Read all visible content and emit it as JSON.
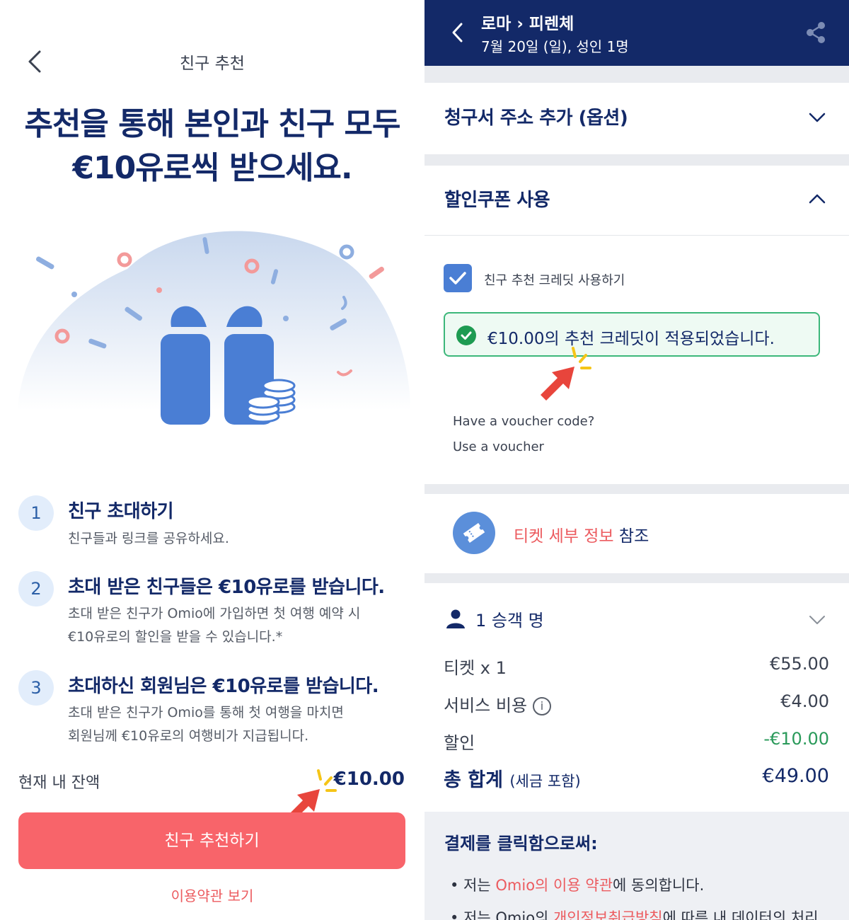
{
  "left": {
    "header_title": "친구 추천",
    "headline_line1": "추천을 통해 본인과 친구 모두",
    "headline_line2": "€10유로씩 받으세요.",
    "steps": [
      {
        "num": "1",
        "title": "친구 초대하기",
        "desc": "친구들과 링크를 공유하세요."
      },
      {
        "num": "2",
        "title": "초대 받은 친구들은 €10유로를 받습니다.",
        "desc_line1": "초대 받은 친구가 Omio에 가입하면 첫 여행 예약 시",
        "desc_line2": "€10유로의 할인을 받을 수 있습니다.*"
      },
      {
        "num": "3",
        "title": "초대하신 회원님은 €10유로를 받습니다.",
        "desc_line1": "초대 받은 친구가 Omio를 통해 첫 여행을 마치면",
        "desc_line2": "회원님께 €10유로의 여행비가 지급됩니다."
      }
    ],
    "balance_label": "현재 내 잔액",
    "balance_value": "€10.00",
    "cta_label": "친구 추천하기",
    "terms_link": "이용약관 보기"
  },
  "right": {
    "route": "로마 › 피렌체",
    "date_line": "7월 20일 (일), 성인 1명",
    "billing_title": "청구서 주소 추가 (옵션)",
    "coupon_title": "할인쿠폰 사용",
    "checkbox_label": "친구 추천 크레딧 사용하기",
    "success_message": "€10.00의 추천 크레딧이 적용되었습니다.",
    "voucher_question": "Have a voucher code?",
    "voucher_link": "Use a voucher",
    "ticket_link_red": "티켓 세부 정보",
    "ticket_link_suffix": " 참조",
    "passengers": "1 승객 명",
    "rows": [
      {
        "label": "티켓 x 1",
        "value": "€55.00"
      },
      {
        "label": "서비스 비용",
        "value": "€4.00"
      },
      {
        "label": "할인",
        "value": "-€10.00"
      }
    ],
    "info_icon_glyph": "i",
    "total_label": "총 합계",
    "total_note": "(세금 포함)",
    "total_value": "€49.00",
    "legal_title": "결제를 클릭함으로써:",
    "legal_1_a": "• 저는 ",
    "legal_1_b": "Omio의 이용 약관",
    "legal_1_c": "에 동의합니다.",
    "legal_2_a": "• 저는 Omio의 ",
    "legal_2_b": "개인정보취급방침",
    "legal_2_c": "에 따른 내 데이터의 처리"
  },
  "colors": {
    "navy": "#132968",
    "coral": "#f8646a",
    "blue": "#4a7ed4",
    "green": "#3cb77a",
    "arrow_red": "#e8453c",
    "spark_yellow": "#f5c518"
  },
  "icons": [
    "chevron-left-icon",
    "share-icon",
    "chevron-down-icon",
    "chevron-up-icon",
    "check-icon",
    "check-circle-icon",
    "ticket-icon",
    "person-icon",
    "info-icon",
    "gift-illustration",
    "pointer-arrow-icon"
  ]
}
